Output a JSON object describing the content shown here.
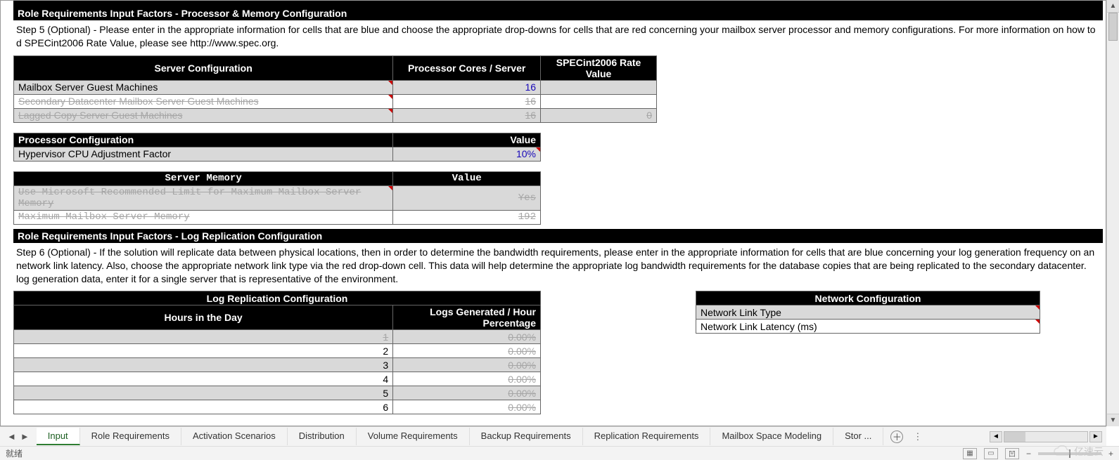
{
  "sections": {
    "proc_mem": {
      "title": "Role Requirements Input Factors - Processor & Memory Configuration",
      "desc": "Step 5 (Optional) - Please enter in the appropriate information for cells that are blue and choose the appropriate drop-downs for cells that are red concerning your mailbox server processor and memory configurations.  For more information on how to d SPECint2006 Rate Value, please see http://www.spec.org."
    },
    "log_repl": {
      "title": "Role Requirements Input Factors - Log Replication Configuration",
      "desc": "Step 6 (Optional) - If the solution will replicate data between physical locations, then in order to determine the bandwidth requirements, please enter in the appropriate information for cells that are blue concerning your log generation frequency on an network link latency.  Also, choose the appropriate network link type via the red drop-down cell.  This data will help determine the appropriate log bandwidth requirements for the database copies that are being replicated to the secondary datacenter.  log generation data, enter it for a single server that is representative of the environment."
    }
  },
  "server_config": {
    "headers": {
      "c1": "Server Configuration",
      "c2": "Processor Cores / Server",
      "c3": "SPECint2006 Rate Value"
    },
    "rows": [
      {
        "label": "Mailbox Server Guest Machines",
        "cores": "16",
        "spec": "",
        "struck": false
      },
      {
        "label": "Secondary Datacenter Mailbox Server Guest Machines",
        "cores": "16",
        "spec": "",
        "struck": true
      },
      {
        "label": "Lagged Copy Server Guest Machines",
        "cores": "16",
        "spec": "0",
        "struck": true
      }
    ]
  },
  "proc_config": {
    "headers": {
      "c1": "Processor Configuration",
      "c2": "Value"
    },
    "rows": [
      {
        "label": "Hypervisor CPU Adjustment Factor",
        "value": "10%"
      }
    ]
  },
  "server_memory": {
    "headers": {
      "c1": "Server Memory",
      "c2": "Value"
    },
    "rows": [
      {
        "label": "Use Microsoft Recommended Limit for Maximum Mailbox Server Memory",
        "value": "Yes"
      },
      {
        "label": "Maximum Mailbox Server Memory",
        "value": "192"
      }
    ]
  },
  "log_table": {
    "title": "Log Replication Configuration",
    "headers": {
      "c1": "Hours in the Day",
      "c2": "Logs Generated / Hour Percentage"
    },
    "rows": [
      {
        "hour": "1",
        "pct": "0.00%",
        "struck": true
      },
      {
        "hour": "2",
        "pct": "0.00%",
        "struck": false
      },
      {
        "hour": "3",
        "pct": "0.00%",
        "struck": false
      },
      {
        "hour": "4",
        "pct": "0.00%",
        "struck": false
      },
      {
        "hour": "5",
        "pct": "0.00%",
        "struck": false
      },
      {
        "hour": "6",
        "pct": "0.00%",
        "struck": false
      }
    ]
  },
  "network_config": {
    "title": "Network Configuration",
    "rows": [
      {
        "label": "Network Link Type",
        "value": ""
      },
      {
        "label": "Network Link Latency (ms)",
        "value": ""
      }
    ]
  },
  "tabs": {
    "items": [
      "Input",
      "Role Requirements",
      "Activation Scenarios",
      "Distribution",
      "Volume Requirements",
      "Backup Requirements",
      "Replication Requirements",
      "Mailbox Space Modeling",
      "Stor  ..."
    ],
    "active": 0
  },
  "status": {
    "ready": "就绪"
  },
  "watermark": "亿速云"
}
